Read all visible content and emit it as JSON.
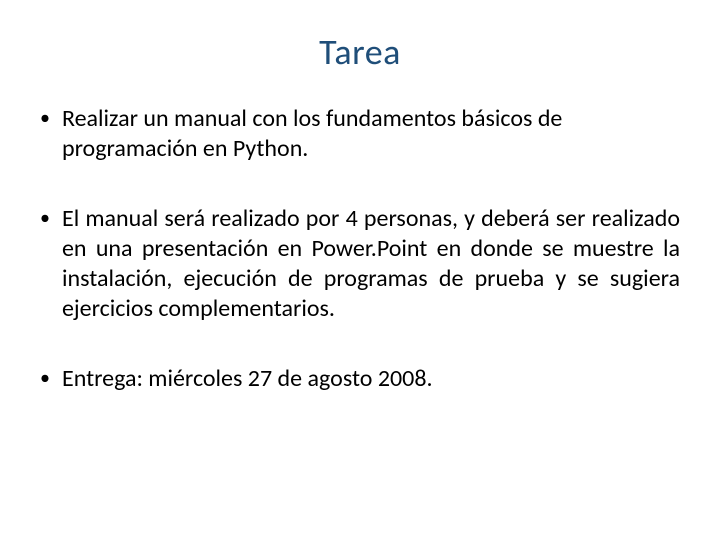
{
  "slide": {
    "title": "Tarea",
    "bullets": [
      {
        "text": "Realizar un manual con los fundamentos básicos de programación en Python."
      },
      {
        "text": "El manual será realizado por 4 personas, y deberá ser realizado en una presentación en Power.Point en donde se muestre la instalación, ejecución de programas de prueba y se sugiera ejercicios complementarios."
      },
      {
        "text": "Entrega: miércoles 27 de agosto 2008."
      }
    ]
  }
}
